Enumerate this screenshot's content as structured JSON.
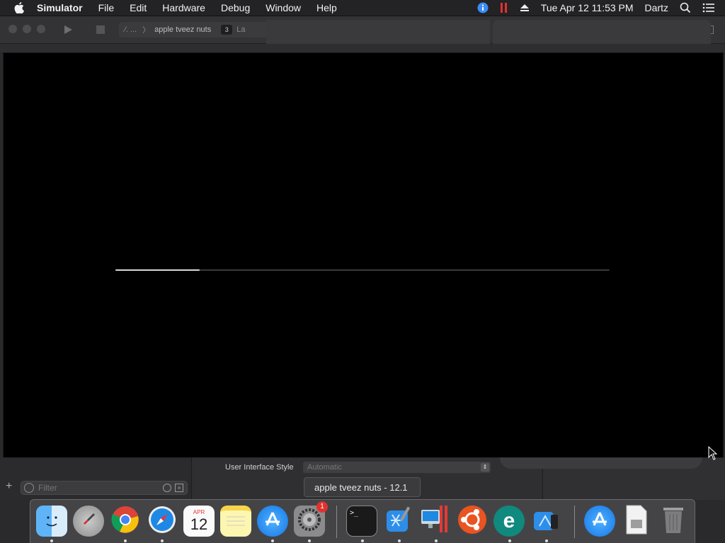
{
  "menubar": {
    "apple_icon": "apple-logo",
    "app_name": "Simulator",
    "menus": [
      "File",
      "Edit",
      "Hardware",
      "Debug",
      "Window",
      "Help"
    ],
    "clock": "Tue Apr 12  11:53 PM",
    "user": "Dartz"
  },
  "xcode": {
    "scheme_target": "apple tveez nuts",
    "activity_count": "3",
    "activity_text": "La"
  },
  "simulator": {
    "boot_progress": 0.17
  },
  "inspector": {
    "ui_style_label": "User Interface Style",
    "ui_style_value": "Automatic"
  },
  "navigator": {
    "filter_placeholder": "Filter"
  },
  "tooltip": {
    "text": "apple tveez nuts - 12.1"
  },
  "dock": {
    "items": [
      {
        "name": "Finder",
        "icon": "finder-icon"
      },
      {
        "name": "Launchpad",
        "icon": "rocket-icon"
      },
      {
        "name": "Chrome",
        "icon": "chrome-icon"
      },
      {
        "name": "Safari",
        "icon": "compass-icon"
      },
      {
        "name": "Calendar",
        "icon": "calendar-icon",
        "month": "APR",
        "day": "12"
      },
      {
        "name": "Notes",
        "icon": "notes-icon"
      },
      {
        "name": "App Store",
        "icon": "appstore-icon"
      },
      {
        "name": "System Preferences",
        "icon": "gear-icon",
        "badge": "1"
      },
      {
        "name": "Terminal",
        "icon": "terminal-icon",
        "prompt": ">_"
      },
      {
        "name": "Xcode",
        "icon": "xcode-icon"
      },
      {
        "name": "Parallels",
        "icon": "parallels-icon"
      },
      {
        "name": "Ubuntu",
        "icon": "ubuntu-icon"
      },
      {
        "name": "ESET",
        "icon": "eset-icon",
        "letter": "e"
      },
      {
        "name": "Simulator",
        "icon": "simulator-icon"
      },
      {
        "name": "App Store Downloads",
        "icon": "appstore-icon"
      },
      {
        "name": "Installer",
        "icon": "installer-icon"
      },
      {
        "name": "Trash",
        "icon": "trash-icon"
      }
    ]
  }
}
